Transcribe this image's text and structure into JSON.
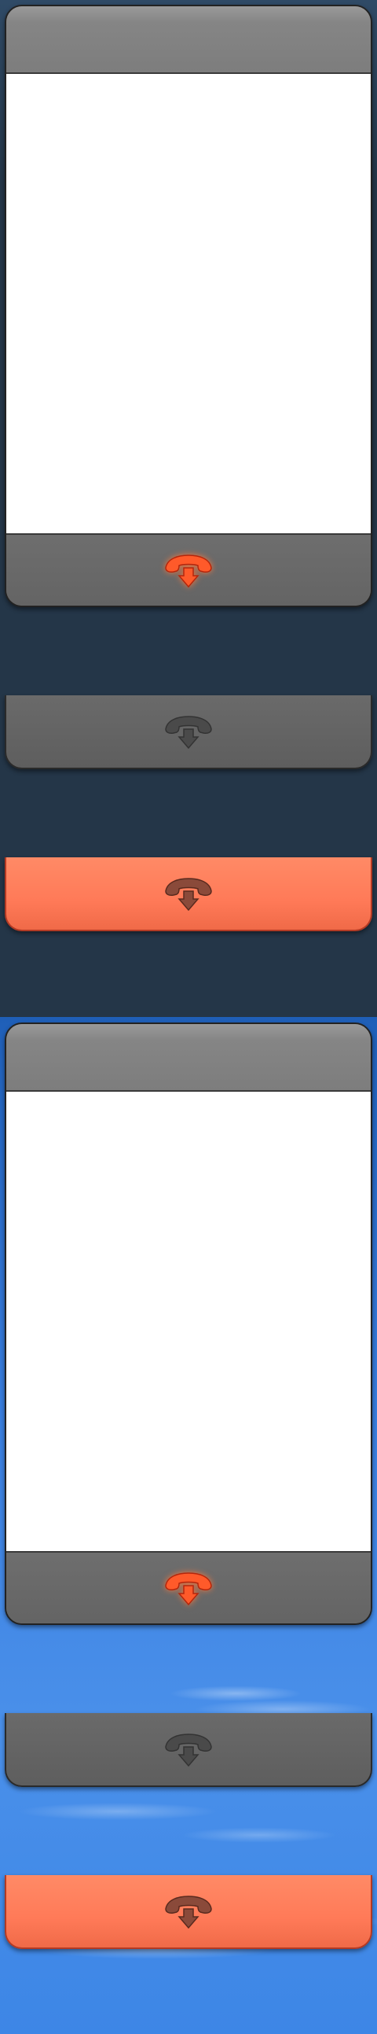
{
  "theme_dark": {
    "call_panel": {
      "title": "",
      "hangup_icon": "hang-up-phone-icon",
      "hangup_state": "active"
    },
    "bars": [
      {
        "variant": "gray",
        "hangup_icon": "hang-up-phone-icon",
        "state": "disabled"
      },
      {
        "variant": "red",
        "hangup_icon": "hang-up-phone-icon",
        "state": "pressed"
      }
    ]
  },
  "theme_sky": {
    "call_panel": {
      "title": "",
      "hangup_icon": "hang-up-phone-icon",
      "hangup_state": "active"
    },
    "bars": [
      {
        "variant": "gray",
        "hangup_icon": "hang-up-phone-icon",
        "state": "disabled"
      },
      {
        "variant": "red",
        "hangup_icon": "hang-up-phone-icon",
        "state": "pressed"
      }
    ]
  },
  "colors": {
    "dark_background": "#243648",
    "sky_background": "#4a90ea",
    "panel_gray": "#646464",
    "header_gray": "#858585",
    "hangup_red": "#ff5a2a",
    "pressed_bar_red": "#ff7a58",
    "disabled_icon_gray": "#4a4a4a"
  }
}
